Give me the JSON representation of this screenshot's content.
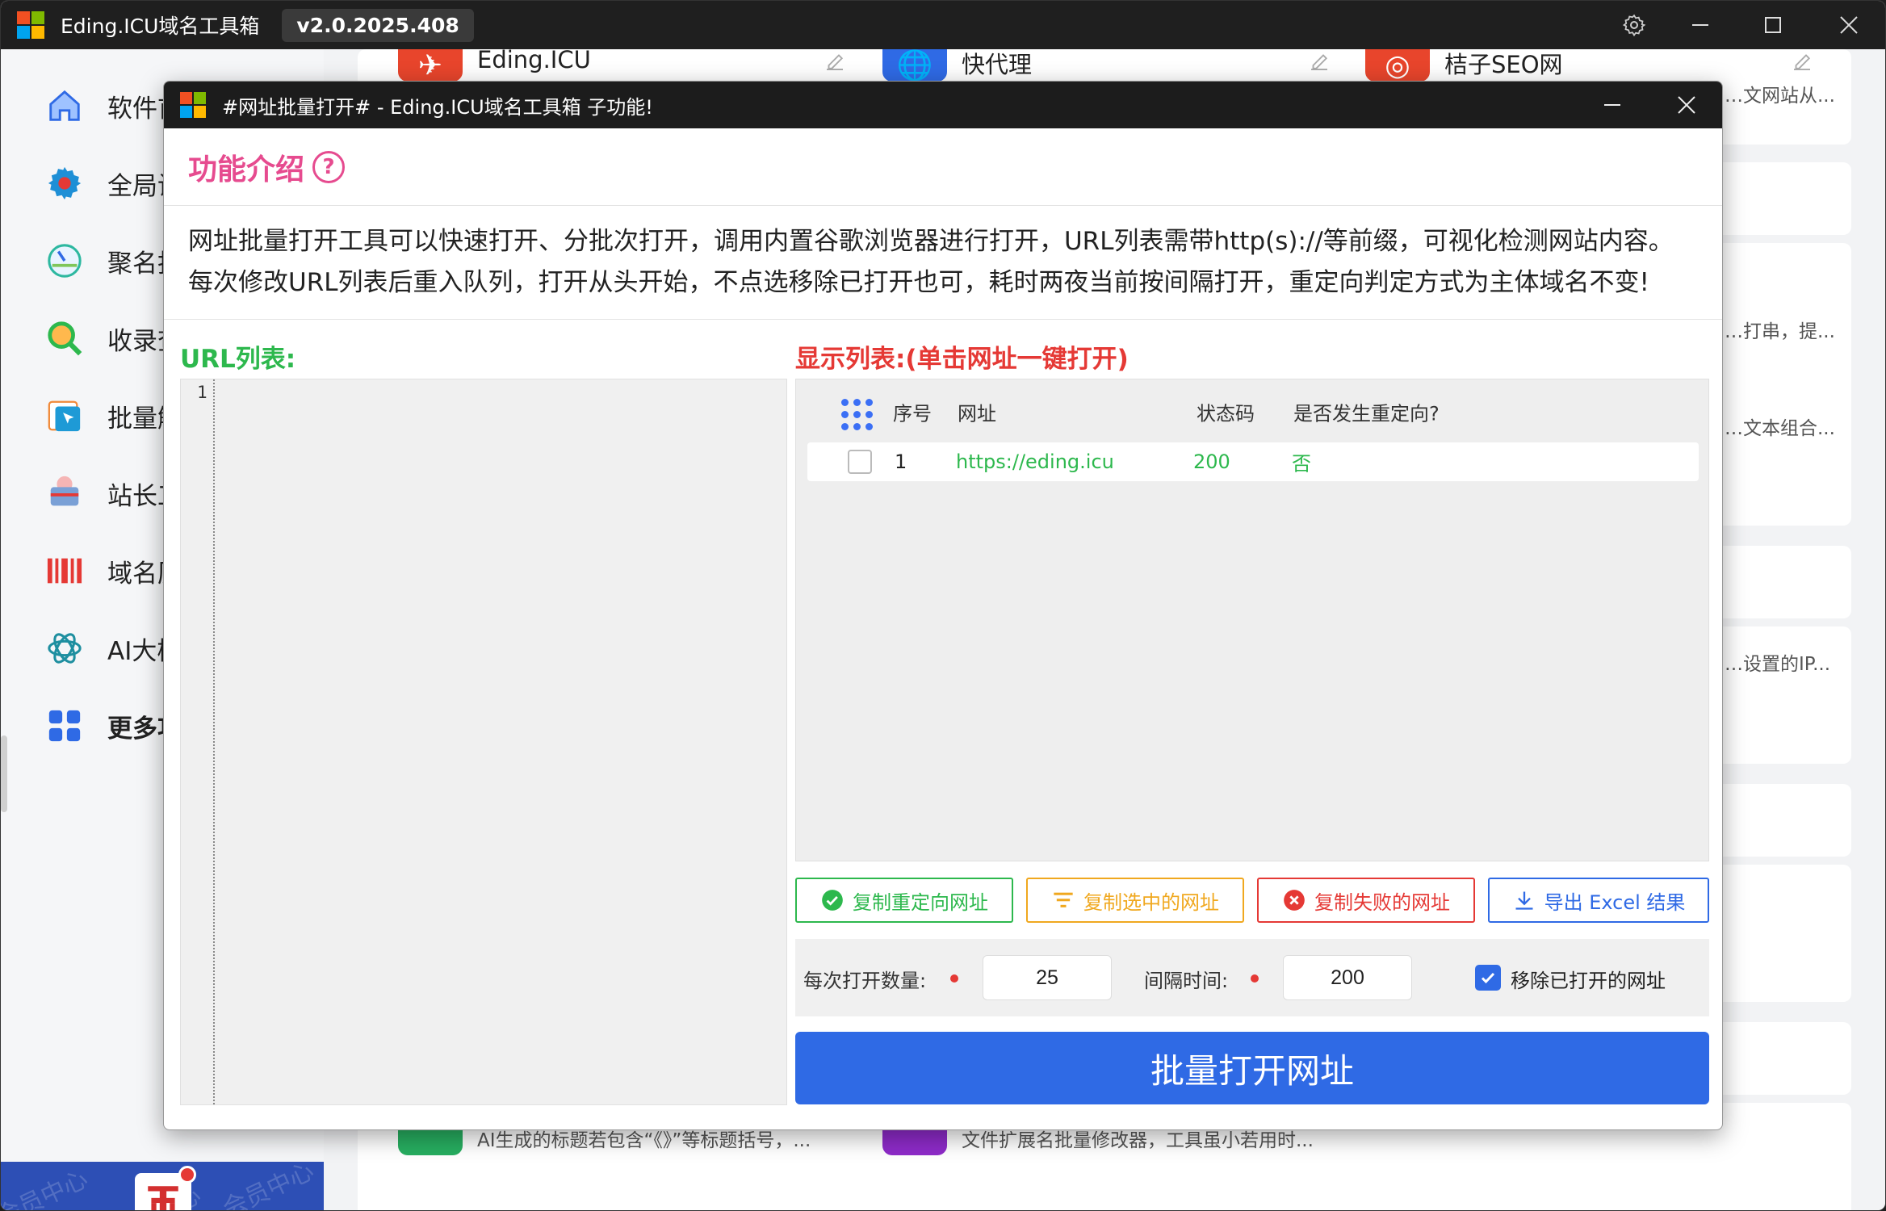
{
  "app": {
    "title": "Eding.ICU域名工具箱",
    "version": "v2.0.2025.408"
  },
  "sidebar": {
    "items": [
      {
        "label": "软件首",
        "icon": "home-icon"
      },
      {
        "label": "全局设",
        "icon": "gear-icon"
      },
      {
        "label": "聚名抢",
        "icon": "gauge-icon"
      },
      {
        "label": "收录查",
        "icon": "magnifier-icon"
      },
      {
        "label": "批量解",
        "icon": "cursor-icon"
      },
      {
        "label": "站长工",
        "icon": "toolbox-icon"
      },
      {
        "label": "域名历",
        "icon": "barcode-icon"
      },
      {
        "label": "AI大模",
        "icon": "openai-icon"
      },
      {
        "label": "更多功",
        "icon": "apps-grid-icon"
      }
    ],
    "vip_watermark": "会员中心"
  },
  "background_tools": {
    "top": [
      {
        "name": "Eding.ICU",
        "color": "#e8452c"
      },
      {
        "name": "快代理",
        "color": "#2f6ae5"
      },
      {
        "name": "桔子SEO网",
        "color": "#e8452c",
        "desc": "…文网站从..."
      }
    ],
    "right_descs": [
      "…打串，提...",
      "…文本组合...",
      "…设置的IP..."
    ],
    "bottom": [
      {
        "desc": "AI生成的标题若包含“《》”等标题括号，...",
        "color": "#27ae60"
      },
      {
        "desc": "文件扩展名批量修改器，工具虽小若用时...",
        "color": "#8e2bc9"
      }
    ]
  },
  "subwindow": {
    "title": "#网址批量打开#  -  Eding.ICU域名工具箱 子功能!",
    "intro_title": "功能介绍",
    "intro_help": "?",
    "intro_lines": [
      "网址批量打开工具可以快速打开、分批次打开，调用内置谷歌浏览器进行打开，URL列表需带http(s)://等前缀，可视化检测网站内容。",
      "每次修改URL列表后重入队列，打开从头开始，不点选移除已打开也可，耗时两夜当前按间隔打开，重定向判定方式为主体域名不变!"
    ],
    "url_label": "URL列表:",
    "editor_line": "1",
    "show_label": "显示列表:(单击网址一键打开)",
    "table": {
      "headers": {
        "index": "序号",
        "url": "网址",
        "status": "状态码",
        "redirect": "是否发生重定向?"
      },
      "rows": [
        {
          "index": "1",
          "url": "https://eding.icu",
          "status": "200",
          "redirect": "否"
        }
      ]
    },
    "actions": {
      "copy_redirect": "复制重定向网址",
      "copy_selected": "复制选中的网址",
      "copy_failed": "复制失败的网址",
      "export_excel": "导出 Excel 结果"
    },
    "settings": {
      "per_open_label": "每次打开数量:",
      "per_open_value": "25",
      "interval_label": "间隔时间:",
      "interval_value": "200",
      "remove_label": "移除已打开的网址",
      "remove_checked": true
    },
    "batch_button": "批量打开网址"
  },
  "colors": {
    "accent_blue": "#2f6ae5",
    "green": "#2db84d",
    "red": "#e53935",
    "orange": "#f0a81f",
    "pink": "#e64b8f"
  }
}
